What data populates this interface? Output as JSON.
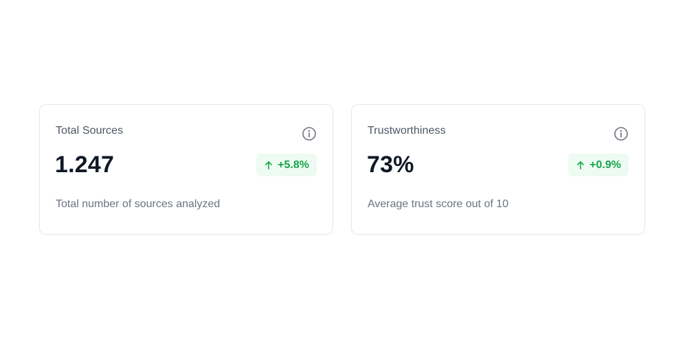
{
  "cards": [
    {
      "title": "Total Sources",
      "value": "1.247",
      "trend": {
        "direction": "up",
        "label": "+5.8%",
        "icon": "arrow-up-icon"
      },
      "description": "Total number of sources analyzed",
      "info_icon": "info-icon"
    },
    {
      "title": "Trustworthiness",
      "value": "73%",
      "trend": {
        "direction": "up",
        "label": "+0.9%",
        "icon": "arrow-up-icon"
      },
      "description": "Average trust score out of 10",
      "info_icon": "info-icon"
    }
  ],
  "colors": {
    "trend_positive": "#16a34a",
    "trend_positive_bg": "#edfbf2",
    "value_text": "#111827",
    "muted_text": "#6b7280",
    "card_border": "#e5e7eb"
  }
}
